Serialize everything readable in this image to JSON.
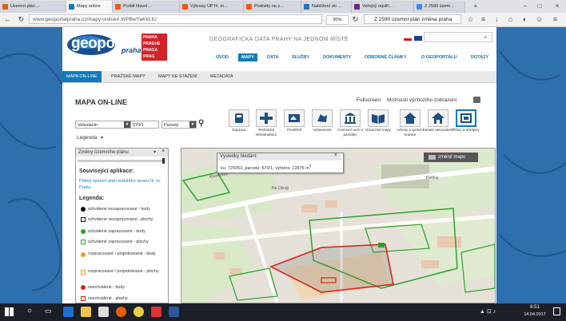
{
  "browser": {
    "tabs": [
      {
        "title": "Územní plán ...",
        "active": false
      },
      {
        "title": "Mapy online",
        "active": true
      },
      {
        "title": "Portál hlavní...",
        "active": false
      },
      {
        "title": "Výkresy ÚP hl. m...",
        "active": false
      },
      {
        "title": "Podněty na z...",
        "active": false
      },
      {
        "title": "Nahlížení do ...",
        "active": false
      },
      {
        "title": "Veřejný rejstří...",
        "active": false
      },
      {
        "title": "Z 2590 územ...",
        "active": false
      }
    ],
    "url": "www.geoportalpraha.cz/mapy-online#.WPBwYaKkLIU",
    "zoom": "90%",
    "search_value": "Z 2590 územní plán změna praha"
  },
  "header": {
    "logo_text": "geoportal",
    "logo_sub": "praha",
    "badge_lines": [
      "PRAHA",
      "PRAGUE",
      "PRAGA",
      "PRAG"
    ],
    "tagline": "GEOGRAFICKÁ DATA PRAHY NA JEDNOM MÍSTĚ",
    "nav": [
      "ÚVOD",
      "MAPY",
      "DATA",
      "SLUŽBY",
      "DOKUMENTY",
      "ODBORNÉ ČLÁNKY",
      "O GEOPORTÁLU",
      "DOTAZY"
    ],
    "active_nav": "MAPY"
  },
  "subnav": [
    "MAPA ON-LINE",
    "PRAŽSKÉ MAPY",
    "MAPY KE STAŽENÍ",
    "METADATA"
  ],
  "content": {
    "title": "MAPA ON-LINE",
    "fullscreen": "Fullscreen",
    "default_view": "Možnosti výchozího zobrazení",
    "search": {
      "area": "Veleslavín",
      "parcel": "570/1",
      "type": "Parcely"
    },
    "legend_label": "Legenda",
    "tools": [
      {
        "label": "Doprava",
        "icon": "bus-icon"
      },
      {
        "label": "Technická infrastruktura",
        "icon": "pipe-icon"
      },
      {
        "label": "Prostředí",
        "icon": "tree-icon"
      },
      {
        "label": "Vybavenost",
        "icon": "hand-icon"
      },
      {
        "label": "Cestovní ruch a památky",
        "icon": "monument-icon"
      },
      {
        "label": "Historické mapy",
        "icon": "book-icon"
      },
      {
        "label": "Adresy a správní hranice",
        "icon": "house-icon"
      },
      {
        "label": "Katastr nemovitostí",
        "icon": "home-icon"
      },
      {
        "label": "Plány a předpisy",
        "icon": "plan-icon"
      }
    ]
  },
  "legend_panel": {
    "title": "Změny územního plánu",
    "related_title": "Související aplikace:",
    "related_link": "Platný územní plán sídelního útvaru hl. m. Prahy",
    "legend_title": "Legenda:",
    "items": [
      {
        "label": "schválené nezapracované - body",
        "symbol": "dot-black"
      },
      {
        "label": "schválené nezapracované - plochy",
        "symbol": "box-black"
      },
      {
        "label": "schválené zapracované - body",
        "symbol": "dot-green"
      },
      {
        "label": "schválené zapracované - plochy",
        "symbol": "box-green"
      },
      {
        "label": "rozpracované / projednávané - body",
        "symbol": "dot-orange"
      },
      {
        "label": "rozpracované / projednávané - plochy",
        "symbol": "box-orange"
      },
      {
        "label": "neschválené - body",
        "symbol": "dot-red"
      },
      {
        "label": "neschválené - plochy",
        "symbol": "box-red"
      }
    ]
  },
  "map": {
    "results_title": "Výsledky hledání:",
    "results_text": "kú: 729353, parcela: 570/1, výměra: 12875 m",
    "results_sup": "2",
    "change_map": "změnit mapu",
    "streets": [
      "Kladenská",
      "Na Okraji",
      "Petřiny"
    ]
  },
  "taskbar": {
    "time": "8:51",
    "date": "14.04.2017"
  }
}
